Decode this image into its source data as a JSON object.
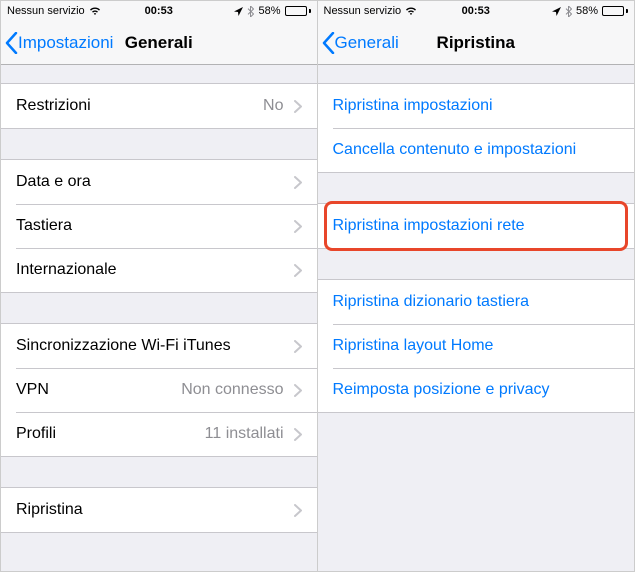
{
  "status": {
    "carrier": "Nessun servizio",
    "time": "00:53",
    "battery_pct": "58%",
    "battery_fill": 58
  },
  "left": {
    "back_label": "Impostazioni",
    "title": "Generali",
    "groups": [
      [
        {
          "label": "Restrizioni",
          "value": "No"
        }
      ],
      [
        {
          "label": "Data e ora"
        },
        {
          "label": "Tastiera"
        },
        {
          "label": "Internazionale"
        }
      ],
      [
        {
          "label": "Sincronizzazione Wi-Fi iTunes"
        },
        {
          "label": "VPN",
          "value": "Non connesso"
        },
        {
          "label": "Profili",
          "value": "11 installati"
        }
      ],
      [
        {
          "label": "Ripristina"
        }
      ]
    ]
  },
  "right": {
    "back_label": "Generali",
    "title": "Ripristina",
    "groups": [
      [
        {
          "label": "Ripristina impostazioni"
        },
        {
          "label": "Cancella contenuto e impostazioni"
        }
      ],
      [
        {
          "label": "Ripristina impostazioni rete",
          "highlight": true
        }
      ],
      [
        {
          "label": "Ripristina dizionario tastiera"
        },
        {
          "label": "Ripristina layout Home"
        },
        {
          "label": "Reimposta posizione e privacy"
        }
      ]
    ]
  }
}
